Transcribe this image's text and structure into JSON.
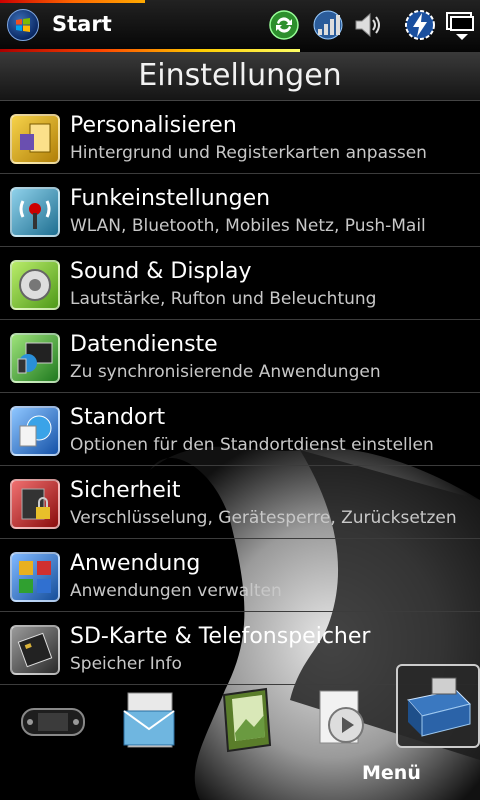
{
  "status_bar": {
    "start_label": "Start",
    "icons": [
      "windows-start-icon",
      "sync-icon",
      "signal-strength-icon",
      "volume-icon",
      "battery-charging-icon",
      "multitask-icon"
    ]
  },
  "header": {
    "title": "Einstellungen"
  },
  "settings_items": [
    {
      "title": "Personalisieren",
      "subtitle": "Hintergrund und Registerkarten anpassen",
      "icon": "personalize-icon",
      "color": "#d9a516"
    },
    {
      "title": "Funkeinstellungen",
      "subtitle": "WLAN, Bluetooth, Mobiles Netz, Push-Mail",
      "icon": "wireless-icon",
      "color": "#2f8fb5"
    },
    {
      "title": "Sound & Display",
      "subtitle": "Lautstärke, Rufton und Beleuchtung",
      "icon": "sound-display-icon",
      "color": "#7cc43a"
    },
    {
      "title": "Datendienste",
      "subtitle": "Zu synchronisierende Anwendungen",
      "icon": "data-services-icon",
      "color": "#3aa33a"
    },
    {
      "title": "Standort",
      "subtitle": "Optionen für den Standortdienst einstellen",
      "icon": "location-icon",
      "color": "#2a74c8"
    },
    {
      "title": "Sicherheit",
      "subtitle": "Verschlüsselung, Gerätesperre, Zurücksetzen",
      "icon": "security-icon",
      "color": "#b81b1b"
    },
    {
      "title": "Anwendung",
      "subtitle": "Anwendungen verwalten",
      "icon": "applications-icon",
      "color": "#2a6bc8"
    },
    {
      "title": "SD-Karte & Telefonspeicher",
      "subtitle": "Speicher Info",
      "icon": "sd-card-icon",
      "color": "#555555"
    }
  ],
  "dock": [
    "game-console-icon",
    "mail-icon",
    "photo-book-icon",
    "media-icon",
    "settings-toolbox-icon"
  ],
  "softkey": {
    "label": "Menü"
  }
}
